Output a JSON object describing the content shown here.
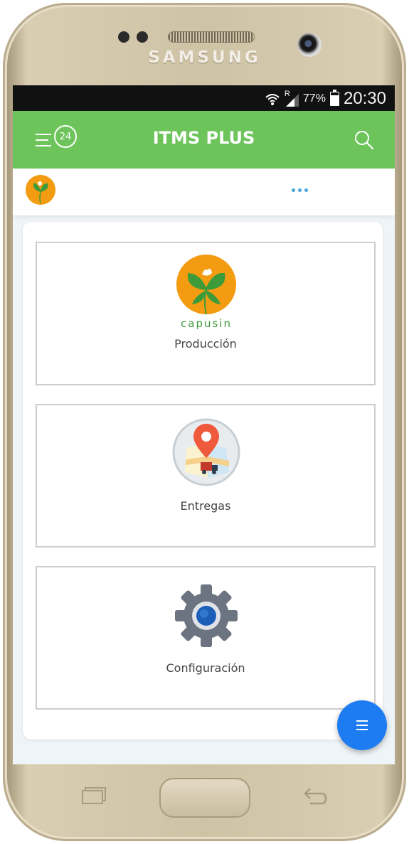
{
  "device": {
    "brand": "SAMSUNG"
  },
  "status_bar": {
    "carrier_indicator": "R",
    "battery_percent": "77%",
    "battery_level": 0.77,
    "time": "20:30"
  },
  "app_bar": {
    "title": "ITMS PLUS",
    "notification_count": "24",
    "menu_icon": "menu-icon",
    "search_icon": "search-icon"
  },
  "sub_bar": {
    "avatar_icon": "capusin-logo-icon",
    "more_icon": "more-horizontal-icon"
  },
  "tiles": [
    {
      "label": "Producción",
      "icon": "capusin-logo-icon",
      "logo_text": "capusin"
    },
    {
      "label": "Entregas",
      "icon": "map-pin-truck-icon"
    },
    {
      "label": "Configuración",
      "icon": "gear-icon"
    }
  ],
  "fab": {
    "icon": "menu-lines-icon"
  },
  "colors": {
    "app_bar": "#6cc45b",
    "fab": "#1e7cf2",
    "logo_orange": "#f39c12",
    "leaf_green": "#3e9b3a",
    "pin_red": "#ef5a3c",
    "gear_gray": "#6b7480",
    "accent_dots": "#47a6d6"
  }
}
